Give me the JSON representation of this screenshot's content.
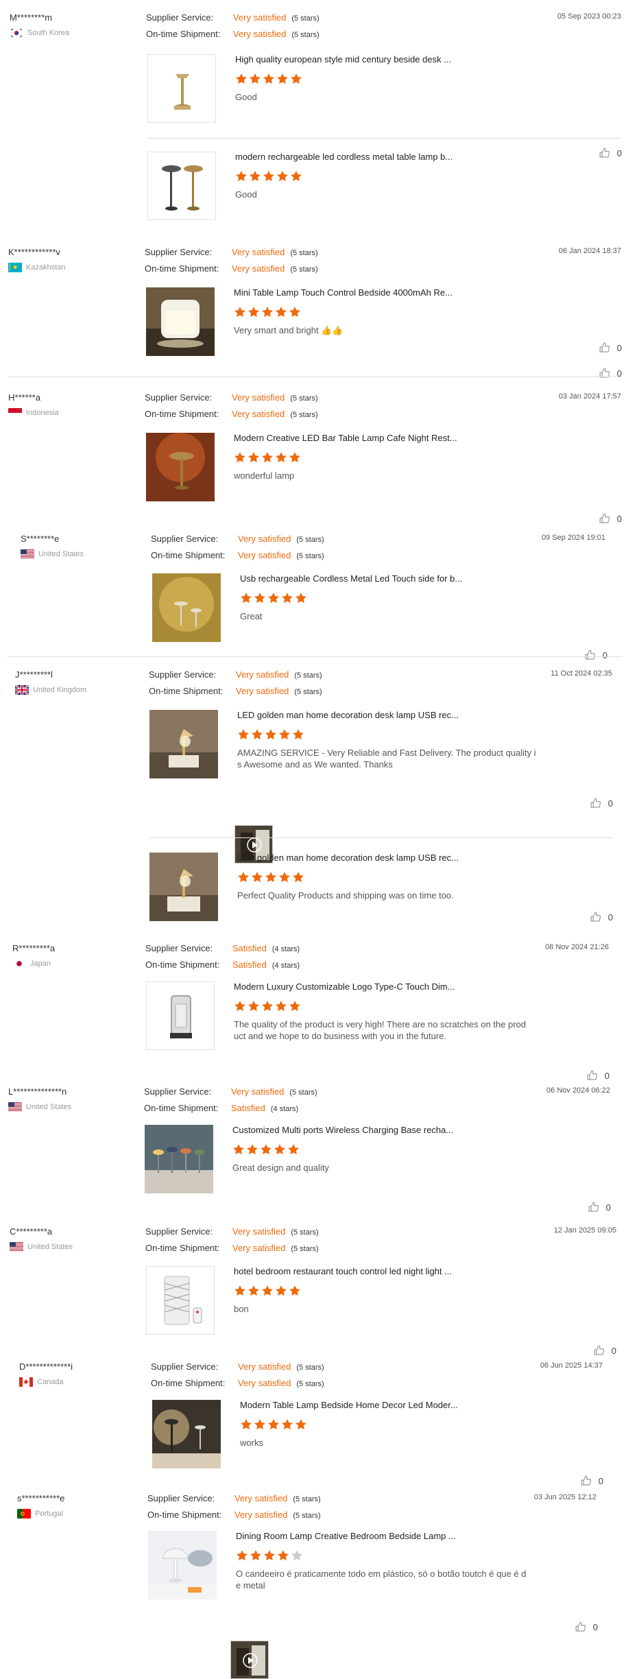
{
  "labels": {
    "supplier": "Supplier Service:",
    "shipment": "On-time Shipment:"
  },
  "colors": {
    "accent": "#ee6a0d",
    "star_empty": "#cccccc"
  },
  "reviews": [
    {
      "user": "M********m",
      "country": "South Korea",
      "flag": "kr",
      "supplier": "Very satisfied",
      "supplier_stars": "(5 stars)",
      "shipment": "Very satisfied",
      "shipment_stars": "(5 stars)",
      "date": "05 Sep 2023 00:23",
      "items": [
        {
          "title": "High quality european style mid century beside desk ...",
          "rating": 5,
          "text": "Good",
          "likes": "0"
        },
        {
          "title": "modern rechargeable led cordless metal table lamp b...",
          "rating": 5,
          "text": "Good",
          "likes": "0"
        }
      ]
    },
    {
      "user": "K************v",
      "country": "Kazakhstan",
      "flag": "kz",
      "supplier": "Very satisfied",
      "supplier_stars": "(5 stars)",
      "shipment": "Very satisfied",
      "shipment_stars": "(5 stars)",
      "date": "06 Jan 2024 18:37",
      "items": [
        {
          "title": "Mini Table Lamp Touch Control Bedside 4000mAh Re...",
          "rating": 5,
          "text": "Very smart and bright 👍👍",
          "likes": "0"
        }
      ]
    },
    {
      "user": "H******a",
      "country": "Indonesia",
      "flag": "id",
      "supplier": "Very satisfied",
      "supplier_stars": "(5 stars)",
      "shipment": "Very satisfied",
      "shipment_stars": "(5 stars)",
      "date": "03 Jan 2024 17:57",
      "items": [
        {
          "title": "Modern Creative LED Bar Table Lamp Cafe Night Rest...",
          "rating": 5,
          "text": "wonderful lamp",
          "likes": "0"
        }
      ]
    },
    {
      "user": "S********e",
      "country": "United States",
      "flag": "us",
      "supplier": "Very satisfied",
      "supplier_stars": "(5 stars)",
      "shipment": "Very satisfied",
      "shipment_stars": "(5 stars)",
      "date": "09 Sep 2024 19:01",
      "items": [
        {
          "title": "Usb rechargeable Cordless Metal Led Touch side for b...",
          "rating": 5,
          "text": "Great",
          "likes": "0"
        }
      ]
    },
    {
      "user": "J*********l",
      "country": "United Kingdom",
      "flag": "gb",
      "supplier": "Very satisfied",
      "supplier_stars": "(5 stars)",
      "shipment": "Very satisfied",
      "shipment_stars": "(5 stars)",
      "date": "11 Oct 2024 02:35",
      "items": [
        {
          "title": "LED golden man home decoration desk lamp USB rec...",
          "rating": 5,
          "text": "AMAZING SERVICE - Very Reliable and Fast Delivery. The product quality i\ns Awesome and as We wanted. Thanks",
          "likes": "0"
        },
        {
          "title": "LED golden man home decoration desk lamp USB rec...",
          "rating": 5,
          "text": "Perfect Quality Products and shipping was on time too.",
          "likes": "0"
        }
      ]
    },
    {
      "user": "R*********a",
      "country": "Japan",
      "flag": "jp",
      "supplier": "Satisfied",
      "supplier_stars": "(4 stars)",
      "shipment": "Satisfied",
      "shipment_stars": "(4 stars)",
      "date": "08 Nov 2024 21:26",
      "items": [
        {
          "title": "Modern Luxury Customizable Logo Type-C Touch Dim...",
          "rating": 5,
          "text": "The quality of the product is very high! There are no scratches on the prod\nuct and we hope to do business with you in the future.",
          "likes": "0"
        }
      ]
    },
    {
      "user": "L**************n",
      "country": "United States",
      "flag": "us",
      "supplier": "Very satisfied",
      "supplier_stars": "(5 stars)",
      "shipment": "Satisfied",
      "shipment_stars": "(4 stars)",
      "date": "06 Nov 2024 06:22",
      "items": [
        {
          "title": "Customized Multi ports Wireless Charging Base recha...",
          "rating": 5,
          "text": "Great design and quality",
          "likes": "0"
        }
      ]
    },
    {
      "user": "C*********a",
      "country": "United States",
      "flag": "us",
      "supplier": "Very satisfied",
      "supplier_stars": "(5 stars)",
      "shipment": "Very satisfied",
      "shipment_stars": "(5 stars)",
      "date": "12 Jan 2025 09:05",
      "items": [
        {
          "title": "hotel bedroom restaurant touch control led night light ...",
          "rating": 5,
          "text": "bon",
          "likes": "0"
        }
      ]
    },
    {
      "user": "D*************i",
      "country": "Canada",
      "flag": "ca",
      "supplier": "Very satisfied",
      "supplier_stars": "(5 stars)",
      "shipment": "Very satisfied",
      "shipment_stars": "(5 stars)",
      "date": "06 Jun 2025 14:37",
      "items": [
        {
          "title": "Modern Table Lamp Bedside Home Decor Led Moder...",
          "rating": 5,
          "text": "works",
          "likes": "0"
        }
      ]
    },
    {
      "user": "s***********e",
      "country": "Portugal",
      "flag": "pt",
      "supplier": "Very satisfied",
      "supplier_stars": "(5 stars)",
      "shipment": "Very satisfied",
      "shipment_stars": "(5 stars)",
      "date": "03 Jun 2025 12:12",
      "items": [
        {
          "title": "Dining Room Lamp Creative Bedroom Bedside Lamp ...",
          "rating": 4,
          "text": "O candeeiro é praticamente todo em plástico, só o botão toutch é que é d\ne metal",
          "likes": "0"
        }
      ]
    }
  ]
}
